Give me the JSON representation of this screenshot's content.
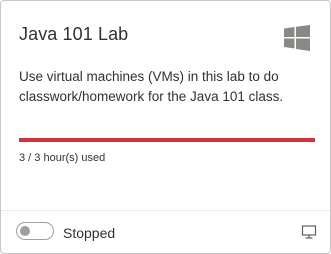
{
  "lab": {
    "title": "Java 101 Lab",
    "os_icon": "windows-logo-icon",
    "description": "Use virtual machines (VMs) in this lab to do classwork/homework for the Java 101 class.",
    "usage": {
      "text": "3 / 3 hour(s) used",
      "used_hours": 3,
      "quota_hours": 3,
      "fraction_used": 1.0,
      "bar_color": "#d13438"
    },
    "vm": {
      "state_label": "Stopped",
      "toggle_on": false,
      "connect_icon": "monitor-connect-icon"
    }
  }
}
